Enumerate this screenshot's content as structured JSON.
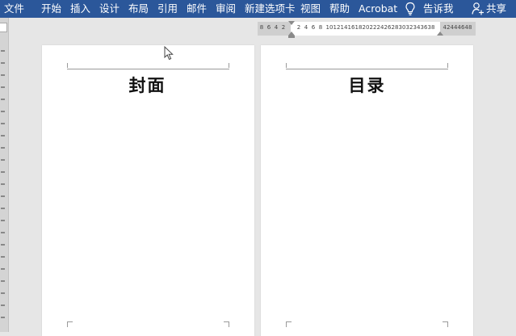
{
  "ribbon": {
    "tabs": [
      "文件",
      "开始",
      "插入",
      "设计",
      "布局",
      "引用",
      "邮件",
      "审阅",
      "新建选项卡",
      "视图",
      "帮助",
      "Acrobat"
    ],
    "tell_me": "告诉我",
    "share": "共享"
  },
  "ruler": {
    "left_numbers": [
      "8",
      "6",
      "4",
      "2"
    ],
    "right_numbers": [
      "2",
      "4",
      "6",
      "8",
      "10",
      "12",
      "14",
      "16",
      "18",
      "20",
      "22",
      "24",
      "26",
      "28",
      "30",
      "32",
      "34",
      "36",
      "38",
      "42",
      "44",
      "46",
      "48"
    ]
  },
  "pages": [
    {
      "heading": "封面"
    },
    {
      "heading": "目录"
    }
  ],
  "colors": {
    "ribbon": "#2b579a",
    "workspace": "#e6e6e6",
    "page": "#ffffff"
  }
}
